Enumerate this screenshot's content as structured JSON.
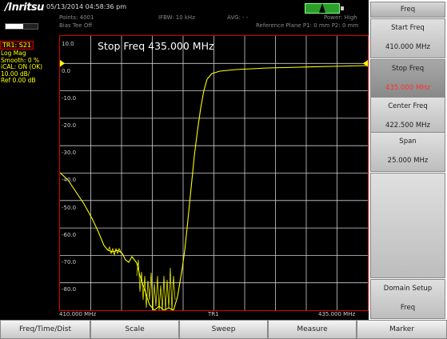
{
  "header": {
    "brand": "/Inritsu",
    "datetime": "05/13/2014 04:58:36 pm",
    "points": "Points: 4001",
    "bias_tee": "Bias Tee Off",
    "ifbw": "IFBW: 10 kHz",
    "avg": "AVG: - -",
    "power": "Power: High",
    "ref_plane": "Reference Plane P1: 0 mm P2: 0 mm"
  },
  "trace_info": {
    "trace": "TR1: S21",
    "format": "Log Mag",
    "smooth": "Smooth: 0 %",
    "ical": "iCAL: ON (OK)",
    "scale": "10.00 dB/",
    "ref": "Ref 0.00 dB"
  },
  "plot": {
    "marker_label": "Stop Freq 435.000 MHz",
    "y_ticks": [
      "10.0",
      "0.0",
      "-10.0",
      "-20.0",
      "-30.0",
      "-40.0",
      "-50.0",
      "-60.0",
      "-70.0",
      "-80.0"
    ],
    "x_start": "410.000 MHz",
    "x_center": "TR1",
    "x_stop": "435.000 MHz"
  },
  "softkeys": {
    "title": "Freq",
    "items": [
      {
        "label": "Start Freq",
        "value": "410.000 MHz"
      },
      {
        "label": "Stop Freq",
        "value": "435.000 MHz"
      },
      {
        "label": "Center Freq",
        "value": "422.500 MHz"
      },
      {
        "label": "Span",
        "value": "25.000 MHz"
      }
    ],
    "domain_setup": "Domain Setup",
    "domain_sub": "Freq"
  },
  "tabs": [
    "Freq/Time/Dist",
    "Scale",
    "Sweep",
    "Measure",
    "Marker"
  ],
  "colors": {
    "trace": "#ffff00",
    "grid": "#cccccc",
    "border": "#dd0000",
    "active_value": "#ff3030"
  }
}
